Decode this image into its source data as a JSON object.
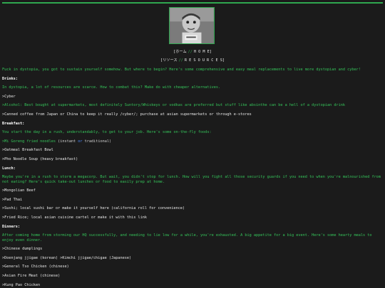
{
  "nav": {
    "home": "ホーム",
    "home_roman": "H O M E",
    "resources": "リソース",
    "resources_roman": "R E S O U R C E S",
    "sep": "//"
  },
  "intro": "Fuck in dystopia, you got to sustain yourself somehow. But where to begin? Here's some comprehensive and easy meal replacements to live more dystopian and cyber!",
  "drinks": {
    "heading": "Drinks:",
    "desc": "In dystopia, a lot of resources are scarce. How to combat this? Make do with cheaper alternatives.",
    "alcohol": ">Alcohol: Best bought at supermarkets, most definitely Suntory/Whiskeys or vodkas are preferred but stuff like absinthe can be a hell of a dystopian drink",
    "coffee": ">Canned coffee from Japan or China to keep it really /cyber/; purchase at asian supermarkets or through e-stores"
  },
  "breakfast": {
    "heading": "Breakfast:",
    "desc": "You start the day in a rush, understandably, to get to your job. Here's some on-the-fly foods:",
    "item1_a": ">Mi Goreng fried noodles",
    "item1_b": "(instant",
    "item1_or": "or",
    "item1_c": "traditional)",
    "item2": ">Oatmeal Breakfast Bowl",
    "item3": ">Pho Noodle Soup (heavy breakfast)"
  },
  "lunch": {
    "heading": "Lunch:",
    "desc": "Maybe you're in a rush to storm a megacorp. But wait, you didn't stop for lunch. How will you fight all those security guards if you need to when you're malnourished from not eating? Here's quick take-out lunches or food to easily prep at home.",
    "item1": ">Mongolian Beef",
    "item2": ">Pad Thai",
    "item3": ">Sushi; local sushi bar or make it yourself here (california roll for convenience)",
    "item4": ">Fried Rice; local asian cuisine cartel or make it with this link"
  },
  "dinners": {
    "heading": "Dinners:",
    "desc": "After coming home from storming our HQ successfully, and needing to lie low for a while, you're exhausted. A big appetite for a big event. Here's some hearty meals to enjoy even dinner.",
    "item1": ">Chinese dumplings",
    "item2": ">Doenjang jjigae (korean) >Kimchi jjigae/chigae (Japanese)",
    "item3": ">General Tso Chicken (chinese)",
    "item4": ">Asian Fire Meat (chinese)",
    "item5": ">Kung Pao Chicken"
  },
  "colors": {
    "accent": "#2fa84f",
    "text_green": "#35c45a",
    "link_blue": "#4f8cff",
    "background": "#1b1b1b"
  }
}
